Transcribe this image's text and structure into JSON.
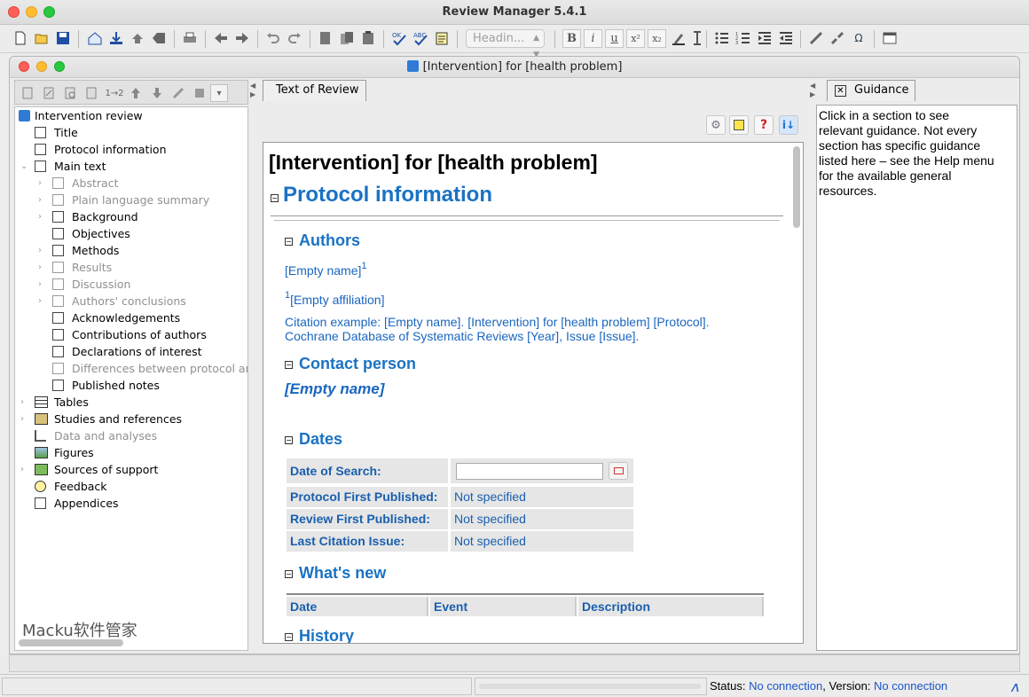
{
  "app": {
    "title": "Review Manager 5.4.1"
  },
  "toolbar": {
    "heading_combo": "Headin...",
    "bold": "B",
    "italic": "i",
    "underline": "u",
    "superscript": "x²",
    "subscript": "x₂",
    "omega": "Ω"
  },
  "document_window": {
    "title": "[Intervention] for [health problem]"
  },
  "tree_toolbar": {
    "renumber": "1→2"
  },
  "tree": {
    "root": "Intervention review",
    "items": [
      {
        "label": "Title"
      },
      {
        "label": "Protocol information"
      },
      {
        "label": "Main text"
      },
      {
        "label": "Abstract"
      },
      {
        "label": "Plain language summary"
      },
      {
        "label": "Background"
      },
      {
        "label": "Objectives"
      },
      {
        "label": "Methods"
      },
      {
        "label": "Results"
      },
      {
        "label": "Discussion"
      },
      {
        "label": "Authors' conclusions"
      },
      {
        "label": "Acknowledgements"
      },
      {
        "label": "Contributions of authors"
      },
      {
        "label": "Declarations of interest"
      },
      {
        "label": "Differences between protocol and"
      },
      {
        "label": "Published notes"
      },
      {
        "label": "Tables"
      },
      {
        "label": "Studies and references"
      },
      {
        "label": "Data and analyses"
      },
      {
        "label": "Figures"
      },
      {
        "label": "Sources of support"
      },
      {
        "label": "Feedback"
      },
      {
        "label": "Appendices"
      }
    ]
  },
  "watermark": "Macku软件管家",
  "center": {
    "tab": "Text of Review",
    "doc_title": "[Intervention] for [health problem]",
    "protocol_heading": "Protocol information",
    "authors_heading": "Authors",
    "author_name": "[Empty name]",
    "author_sup": "1",
    "affiliation_sup": "1",
    "affiliation": "[Empty affiliation]",
    "citation_line1": "Citation example: [Empty name]. [Intervention] for [health problem] [Protocol].",
    "citation_line2": "Cochrane Database of Systematic Reviews [Year], Issue [Issue].",
    "contact_heading": "Contact person",
    "contact_name": "[Empty name]",
    "dates_heading": "Dates",
    "dates": {
      "search_label": "Date of Search:",
      "search_value": "",
      "rows": [
        {
          "label": "Protocol First Published:",
          "value": "Not specified"
        },
        {
          "label": "Review First Published:",
          "value": "Not specified"
        },
        {
          "label": "Last Citation Issue:",
          "value": "Not specified"
        }
      ]
    },
    "whats_new_heading": "What's new",
    "whats_new_columns": [
      "Date",
      "Event",
      "Description"
    ],
    "history_heading": "History"
  },
  "guidance": {
    "tab": "Guidance",
    "lines": [
      "Click in a section to see",
      "relevant guidance. Not every",
      "section has specific guidance",
      "listed here – see the Help menu",
      "for the available general",
      "resources."
    ]
  },
  "status": {
    "status_label": "Status:",
    "status_value": "No connection",
    "version_label": ", Version:",
    "version_value": "No connection"
  }
}
